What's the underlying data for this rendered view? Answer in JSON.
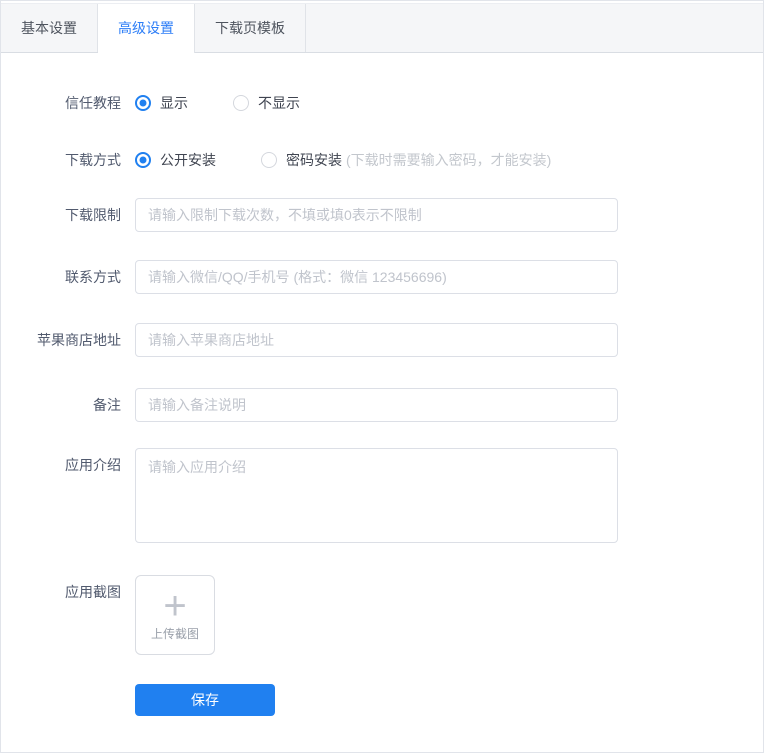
{
  "tabs": [
    {
      "label": "基本设置",
      "active": false
    },
    {
      "label": "高级设置",
      "active": true
    },
    {
      "label": "下载页模板",
      "active": false
    }
  ],
  "form": {
    "trust_tutorial": {
      "label": "信任教程",
      "option_show": "显示",
      "option_hide": "不显示",
      "selected": "显示"
    },
    "download_method": {
      "label": "下载方式",
      "option_public": "公开安装",
      "option_password": "密码安装",
      "password_hint": "(下载时需要输入密码，才能安装)",
      "selected": "公开安装"
    },
    "download_limit": {
      "label": "下载限制",
      "placeholder": "请输入限制下载次数，不填或填0表示不限制",
      "value": ""
    },
    "contact": {
      "label": "联系方式",
      "placeholder": "请输入微信/QQ/手机号 (格式：微信 123456696)",
      "value": ""
    },
    "apple_store": {
      "label": "苹果商店地址",
      "placeholder": "请输入苹果商店地址",
      "value": ""
    },
    "remark": {
      "label": "备注",
      "placeholder": "请输入备注说明",
      "value": ""
    },
    "app_intro": {
      "label": "应用介绍",
      "placeholder": "请输入应用介绍",
      "value": ""
    },
    "app_screenshot": {
      "label": "应用截图",
      "plus_icon": "+",
      "upload_text": "上传截图"
    },
    "save_button": "保存"
  },
  "colors": {
    "accent": "#2080f0",
    "tab_active_text": "#2d7ef7",
    "tabbar_bg": "#f5f6f8",
    "border": "#dcdfe6",
    "placeholder_text": "#c0c4cc",
    "label_text": "#515a6e"
  }
}
